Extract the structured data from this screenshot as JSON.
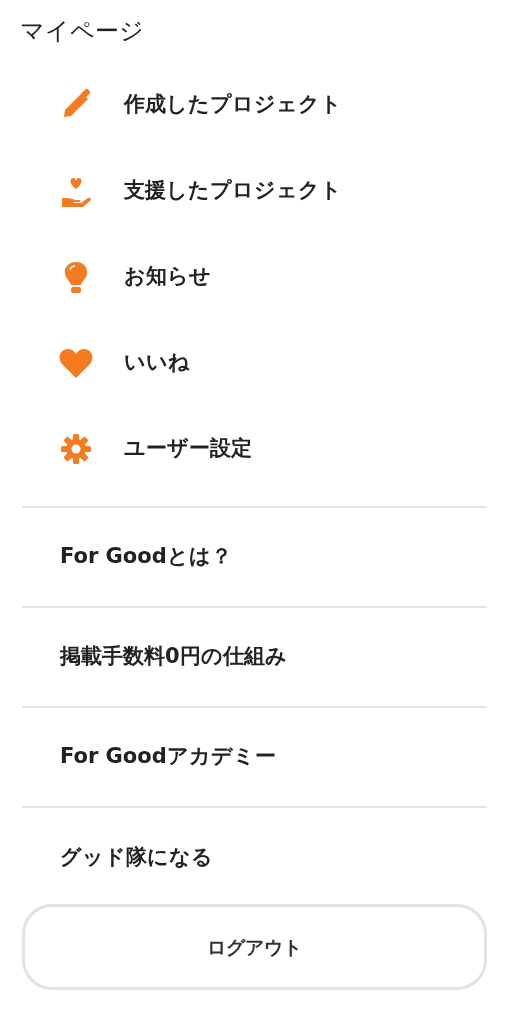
{
  "title": "マイページ",
  "mypage_items": [
    {
      "label": "作成したプロジェクト"
    },
    {
      "label": "支援したプロジェクト"
    },
    {
      "label": "お知らせ"
    },
    {
      "label": "いいね"
    },
    {
      "label": "ユーザー設定"
    }
  ],
  "links": [
    {
      "label": "For Goodとは？"
    },
    {
      "label": "掲載手数料0円の仕組み"
    },
    {
      "label": "For Goodアカデミー"
    },
    {
      "label": "グッド隊になる"
    }
  ],
  "logout_button": "ログアウト"
}
